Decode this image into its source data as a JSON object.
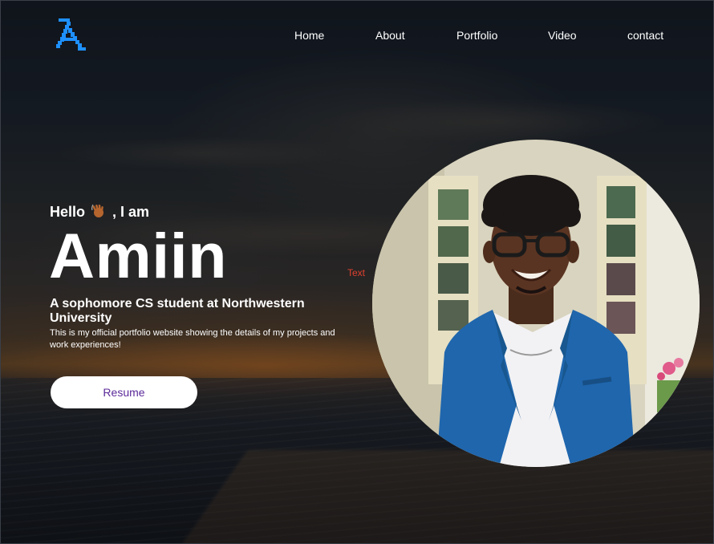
{
  "logo": {
    "glyph_name": "logo-a-icon",
    "color": "#1e90ff"
  },
  "nav": {
    "items": [
      {
        "label": "Home"
      },
      {
        "label": "About"
      },
      {
        "label": "Portfolio"
      },
      {
        "label": "Video"
      },
      {
        "label": "contact"
      }
    ]
  },
  "hero": {
    "greeting_before": "Hello",
    "greeting_emoji": "waving-hand-icon",
    "greeting_after": ", I am",
    "name": "Amiin",
    "tagline": "A sophomore CS student at Northwestern University",
    "description": "This is my official portfolio website showing the details of my projects and work experiences!",
    "resume_label": "Resume",
    "floating_label": "Text"
  },
  "colors": {
    "accent_text": "#5b2a9a",
    "floating_text": "#e0412f",
    "blazer": "#1f66ad"
  }
}
